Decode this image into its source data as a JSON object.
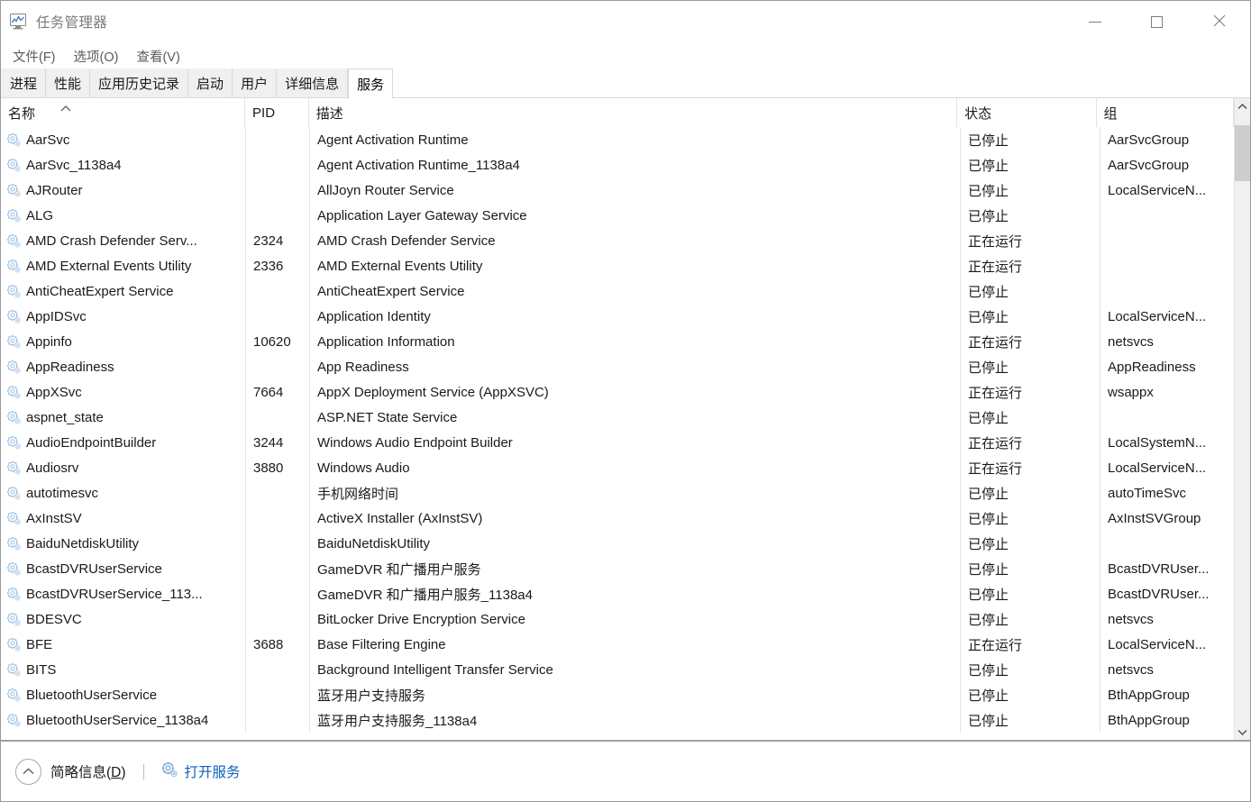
{
  "window": {
    "title": "任务管理器",
    "icon": "task-manager-icon",
    "controls": {
      "minimize": "最小化",
      "maximize": "最大化",
      "close": "关闭"
    }
  },
  "menu": {
    "items": [
      {
        "label": "文件(F)"
      },
      {
        "label": "选项(O)"
      },
      {
        "label": "查看(V)"
      }
    ]
  },
  "tabs": [
    {
      "label": "进程",
      "active": false
    },
    {
      "label": "性能",
      "active": false
    },
    {
      "label": "应用历史记录",
      "active": false
    },
    {
      "label": "启动",
      "active": false
    },
    {
      "label": "用户",
      "active": false
    },
    {
      "label": "详细信息",
      "active": false
    },
    {
      "label": "服务",
      "active": true
    }
  ],
  "table": {
    "sort": {
      "column": "名称",
      "direction": "ascending"
    },
    "columns": [
      {
        "key": "name",
        "label": "名称"
      },
      {
        "key": "pid",
        "label": "PID"
      },
      {
        "key": "desc",
        "label": "描述"
      },
      {
        "key": "status",
        "label": "状态"
      },
      {
        "key": "group",
        "label": "组"
      }
    ],
    "rows": [
      {
        "name": "AarSvc",
        "pid": "",
        "desc": "Agent Activation Runtime",
        "status": "已停止",
        "group": "AarSvcGroup"
      },
      {
        "name": "AarSvc_1138a4",
        "pid": "",
        "desc": "Agent Activation Runtime_1138a4",
        "status": "已停止",
        "group": "AarSvcGroup"
      },
      {
        "name": "AJRouter",
        "pid": "",
        "desc": "AllJoyn Router Service",
        "status": "已停止",
        "group": "LocalServiceN..."
      },
      {
        "name": "ALG",
        "pid": "",
        "desc": "Application Layer Gateway Service",
        "status": "已停止",
        "group": ""
      },
      {
        "name": "AMD Crash Defender Serv...",
        "pid": "2324",
        "desc": "AMD Crash Defender Service",
        "status": "正在运行",
        "group": ""
      },
      {
        "name": "AMD External Events Utility",
        "pid": "2336",
        "desc": "AMD External Events Utility",
        "status": "正在运行",
        "group": ""
      },
      {
        "name": "AntiCheatExpert Service",
        "pid": "",
        "desc": "AntiCheatExpert Service",
        "status": "已停止",
        "group": ""
      },
      {
        "name": "AppIDSvc",
        "pid": "",
        "desc": "Application Identity",
        "status": "已停止",
        "group": "LocalServiceN..."
      },
      {
        "name": "Appinfo",
        "pid": "10620",
        "desc": "Application Information",
        "status": "正在运行",
        "group": "netsvcs"
      },
      {
        "name": "AppReadiness",
        "pid": "",
        "desc": "App Readiness",
        "status": "已停止",
        "group": "AppReadiness"
      },
      {
        "name": "AppXSvc",
        "pid": "7664",
        "desc": "AppX Deployment Service (AppXSVC)",
        "status": "正在运行",
        "group": "wsappx"
      },
      {
        "name": "aspnet_state",
        "pid": "",
        "desc": "ASP.NET State Service",
        "status": "已停止",
        "group": ""
      },
      {
        "name": "AudioEndpointBuilder",
        "pid": "3244",
        "desc": "Windows Audio Endpoint Builder",
        "status": "正在运行",
        "group": "LocalSystemN..."
      },
      {
        "name": "Audiosrv",
        "pid": "3880",
        "desc": "Windows Audio",
        "status": "正在运行",
        "group": "LocalServiceN..."
      },
      {
        "name": "autotimesvc",
        "pid": "",
        "desc": "手机网络时间",
        "status": "已停止",
        "group": "autoTimeSvc"
      },
      {
        "name": "AxInstSV",
        "pid": "",
        "desc": "ActiveX Installer (AxInstSV)",
        "status": "已停止",
        "group": "AxInstSVGroup"
      },
      {
        "name": "BaiduNetdiskUtility",
        "pid": "",
        "desc": "BaiduNetdiskUtility",
        "status": "已停止",
        "group": ""
      },
      {
        "name": "BcastDVRUserService",
        "pid": "",
        "desc": "GameDVR 和广播用户服务",
        "status": "已停止",
        "group": "BcastDVRUser..."
      },
      {
        "name": "BcastDVRUserService_113...",
        "pid": "",
        "desc": "GameDVR 和广播用户服务_1138a4",
        "status": "已停止",
        "group": "BcastDVRUser..."
      },
      {
        "name": "BDESVC",
        "pid": "",
        "desc": "BitLocker Drive Encryption Service",
        "status": "已停止",
        "group": "netsvcs"
      },
      {
        "name": "BFE",
        "pid": "3688",
        "desc": "Base Filtering Engine",
        "status": "正在运行",
        "group": "LocalServiceN..."
      },
      {
        "name": "BITS",
        "pid": "",
        "desc": "Background Intelligent Transfer Service",
        "status": "已停止",
        "group": "netsvcs"
      },
      {
        "name": "BluetoothUserService",
        "pid": "",
        "desc": "蓝牙用户支持服务",
        "status": "已停止",
        "group": "BthAppGroup"
      },
      {
        "name": "BluetoothUserService_1138a4",
        "pid": "",
        "desc": "蓝牙用户支持服务_1138a4",
        "status": "已停止",
        "group": "BthAppGroup"
      }
    ]
  },
  "scrollbar": {
    "up_icon": "chevron-up-icon",
    "down_icon": "chevron-down-icon",
    "thumb_position_percent": 2
  },
  "statusbar": {
    "collapse_icon": "chevron-up-icon",
    "fewer_details_label": "简略信息(D)",
    "fewer_details_accel": "D",
    "open_services_icon": "services-gear-icon",
    "open_services_label": "打开服务"
  },
  "colors": {
    "link": "#1061b8",
    "title_text": "#7a7a7a",
    "tab_active_bg": "#ffffff",
    "tab_bg": "#f0f0f0",
    "grid_line": "#e2e2e2",
    "scroll_thumb": "#cdcdcd"
  }
}
